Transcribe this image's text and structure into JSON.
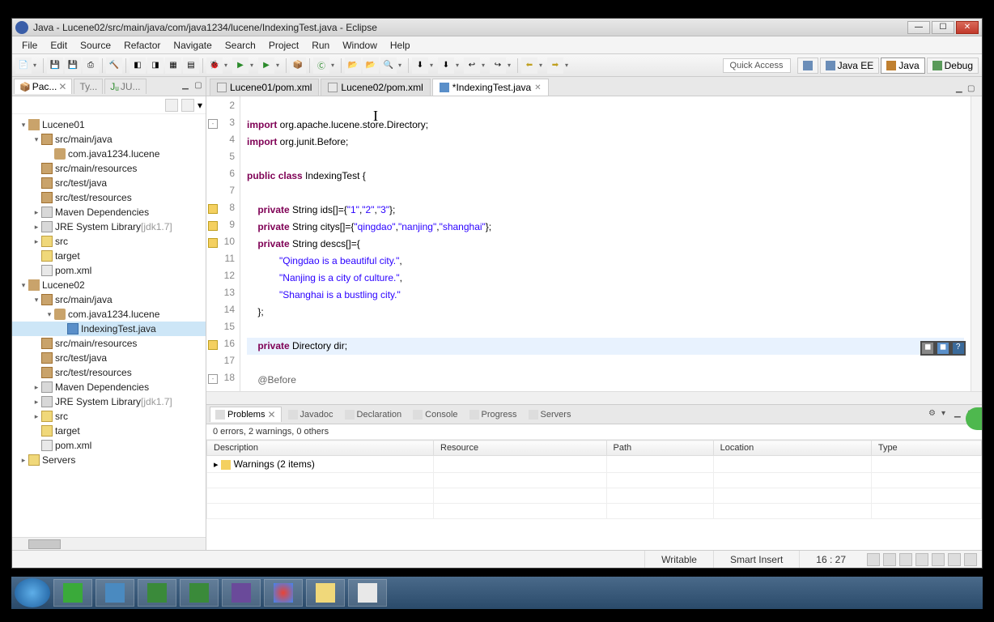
{
  "title": "Java - Lucene02/src/main/java/com/java1234/lucene/IndexingTest.java - Eclipse",
  "menus": [
    "File",
    "Edit",
    "Source",
    "Refactor",
    "Navigate",
    "Search",
    "Project",
    "Run",
    "Window",
    "Help"
  ],
  "quick_access": "Quick Access",
  "perspectives": {
    "java_ee": "Java EE",
    "java": "Java",
    "debug": "Debug"
  },
  "package_explorer": {
    "tab_label": "Pac...",
    "tab2": "Ty...",
    "tab3": "JU...",
    "tree": [
      {
        "d": 0,
        "tw": "▾",
        "ic": "proj",
        "label": "Lucene01"
      },
      {
        "d": 1,
        "tw": "▾",
        "ic": "srcf",
        "label": "src/main/java"
      },
      {
        "d": 2,
        "tw": "",
        "ic": "pkg",
        "label": "com.java1234.lucene"
      },
      {
        "d": 1,
        "tw": "",
        "ic": "srcf",
        "label": "src/main/resources"
      },
      {
        "d": 1,
        "tw": "",
        "ic": "srcf",
        "label": "src/test/java"
      },
      {
        "d": 1,
        "tw": "",
        "ic": "srcf",
        "label": "src/test/resources"
      },
      {
        "d": 1,
        "tw": "▸",
        "ic": "lib",
        "label": "Maven Dependencies"
      },
      {
        "d": 1,
        "tw": "▸",
        "ic": "lib",
        "label": "JRE System Library",
        "suffix": "[jdk1.7]"
      },
      {
        "d": 1,
        "tw": "▸",
        "ic": "folder",
        "label": "src"
      },
      {
        "d": 1,
        "tw": "",
        "ic": "folder",
        "label": "target"
      },
      {
        "d": 1,
        "tw": "",
        "ic": "file",
        "label": "pom.xml"
      },
      {
        "d": 0,
        "tw": "▾",
        "ic": "proj",
        "label": "Lucene02"
      },
      {
        "d": 1,
        "tw": "▾",
        "ic": "srcf",
        "label": "src/main/java"
      },
      {
        "d": 2,
        "tw": "▾",
        "ic": "pkg",
        "label": "com.java1234.lucene"
      },
      {
        "d": 3,
        "tw": "",
        "ic": "java",
        "label": "IndexingTest.java",
        "sel": true
      },
      {
        "d": 1,
        "tw": "",
        "ic": "srcf",
        "label": "src/main/resources"
      },
      {
        "d": 1,
        "tw": "",
        "ic": "srcf",
        "label": "src/test/java"
      },
      {
        "d": 1,
        "tw": "",
        "ic": "srcf",
        "label": "src/test/resources"
      },
      {
        "d": 1,
        "tw": "▸",
        "ic": "lib",
        "label": "Maven Dependencies"
      },
      {
        "d": 1,
        "tw": "▸",
        "ic": "lib",
        "label": "JRE System Library",
        "suffix": "[jdk1.7]"
      },
      {
        "d": 1,
        "tw": "▸",
        "ic": "folder",
        "label": "src"
      },
      {
        "d": 1,
        "tw": "",
        "ic": "folder",
        "label": "target"
      },
      {
        "d": 1,
        "tw": "",
        "ic": "file",
        "label": "pom.xml"
      },
      {
        "d": 0,
        "tw": "▸",
        "ic": "folder",
        "label": "Servers"
      }
    ]
  },
  "editor_tabs": [
    {
      "label": "Lucene01/pom.xml",
      "icon": "ei"
    },
    {
      "label": "Lucene02/pom.xml",
      "icon": "ei"
    },
    {
      "label": "*IndexingTest.java",
      "icon": "ej",
      "active": true,
      "closable": true
    }
  ],
  "code_lines": [
    {
      "n": 2,
      "html": ""
    },
    {
      "n": 3,
      "html": "<span class='kw'>import</span> org.apache.lucene.store.Directory;",
      "mark": "fold"
    },
    {
      "n": 4,
      "html": "<span class='kw'>import</span> org.junit.Before;"
    },
    {
      "n": 5,
      "html": ""
    },
    {
      "n": 6,
      "html": "<span class='kw'>public</span> <span class='kw'>class</span> IndexingTest {"
    },
    {
      "n": 7,
      "html": ""
    },
    {
      "n": 8,
      "html": "    <span class='kw'>private</span> String ids[]={<span class='str'>\"1\"</span>,<span class='str'>\"2\"</span>,<span class='str'>\"3\"</span>};",
      "mark": "warn"
    },
    {
      "n": 9,
      "html": "    <span class='kw'>private</span> String citys[]={<span class='str'>\"qingdao\"</span>,<span class='str'>\"nanjing\"</span>,<span class='str'>\"shanghai\"</span>};",
      "mark": "warn"
    },
    {
      "n": 10,
      "html": "    <span class='kw'>private</span> String descs[]={",
      "mark": "warn"
    },
    {
      "n": 11,
      "html": "            <span class='str'>\"Qingdao is a beautiful city.\"</span>,"
    },
    {
      "n": 12,
      "html": "            <span class='str'>\"Nanjing is a city of culture.\"</span>,"
    },
    {
      "n": 13,
      "html": "            <span class='str'>\"Shanghai is a bustling city.\"</span>"
    },
    {
      "n": 14,
      "html": "    };"
    },
    {
      "n": 15,
      "html": ""
    },
    {
      "n": 16,
      "html": "    <span class='kw'>private</span> Directory dir;",
      "hl": true,
      "mark": "warn"
    },
    {
      "n": 17,
      "html": ""
    },
    {
      "n": 18,
      "html": "    <span class='ann'>@Before</span>",
      "mark": "fold"
    }
  ],
  "problems": {
    "tabs": [
      "Problems",
      "Javadoc",
      "Declaration",
      "Console",
      "Progress",
      "Servers"
    ],
    "summary": "0 errors, 2 warnings, 0 others",
    "columns": [
      "Description",
      "Resource",
      "Path",
      "Location",
      "Type"
    ],
    "row": "Warnings (2 items)"
  },
  "status": {
    "writable": "Writable",
    "insert": "Smart Insert",
    "pos": "16 : 27"
  }
}
